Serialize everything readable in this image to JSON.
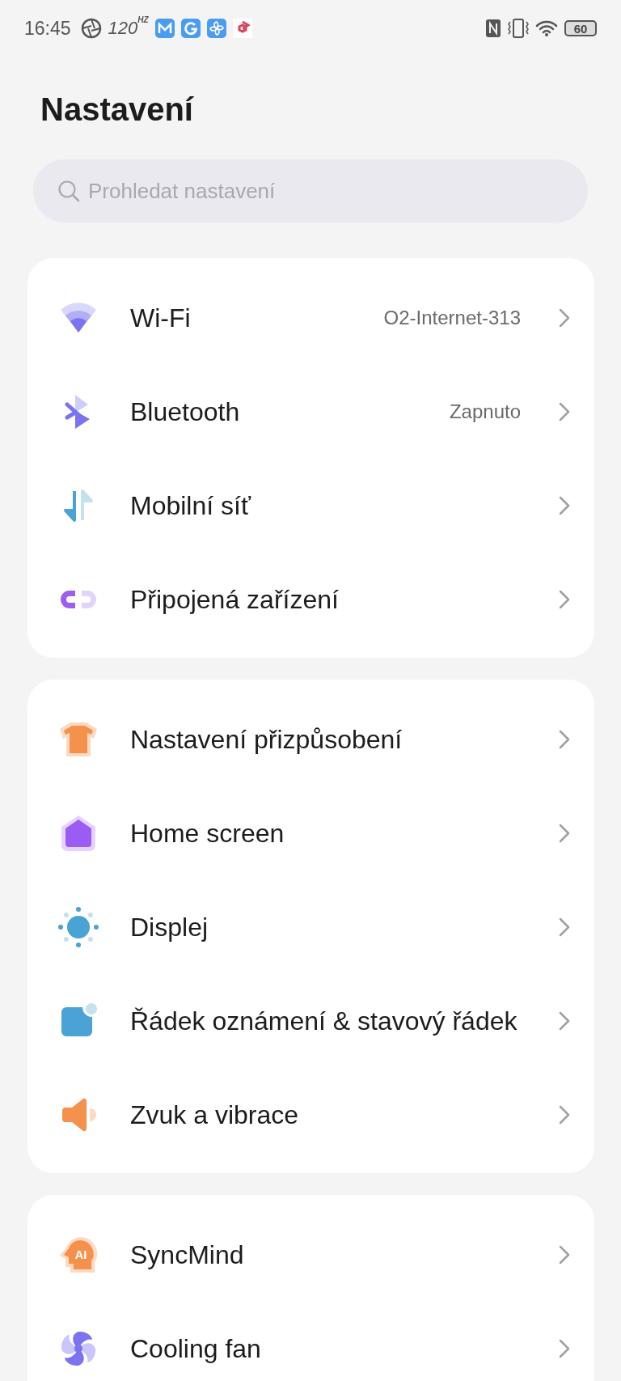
{
  "status_bar": {
    "time": "16:45",
    "refresh_rate": "120",
    "refresh_unit": "HZ",
    "battery": "60"
  },
  "title": "Nastavení",
  "search": {
    "placeholder": "Prohledat nastavení"
  },
  "groups": [
    {
      "items": [
        {
          "kind": "wifi",
          "label": "Wi-Fi",
          "value": "O2-Internet-313"
        },
        {
          "kind": "bluetooth",
          "label": "Bluetooth",
          "value": "Zapnuto"
        },
        {
          "kind": "mobile",
          "label": "Mobilní síť"
        },
        {
          "kind": "link",
          "label": "Připojená zařízení"
        }
      ]
    },
    {
      "items": [
        {
          "kind": "shirt",
          "label": "Nastavení přizpůsobení"
        },
        {
          "kind": "home",
          "label": "Home screen"
        },
        {
          "kind": "sun",
          "label": "Displej"
        },
        {
          "kind": "notification",
          "label": "Řádek oznámení & stavový řádek"
        },
        {
          "kind": "speaker",
          "label": "Zvuk a vibrace"
        }
      ]
    },
    {
      "items": [
        {
          "kind": "head",
          "label": "SyncMind",
          "icon_text": "AI"
        },
        {
          "kind": "fan",
          "label": "Cooling fan"
        }
      ]
    }
  ]
}
